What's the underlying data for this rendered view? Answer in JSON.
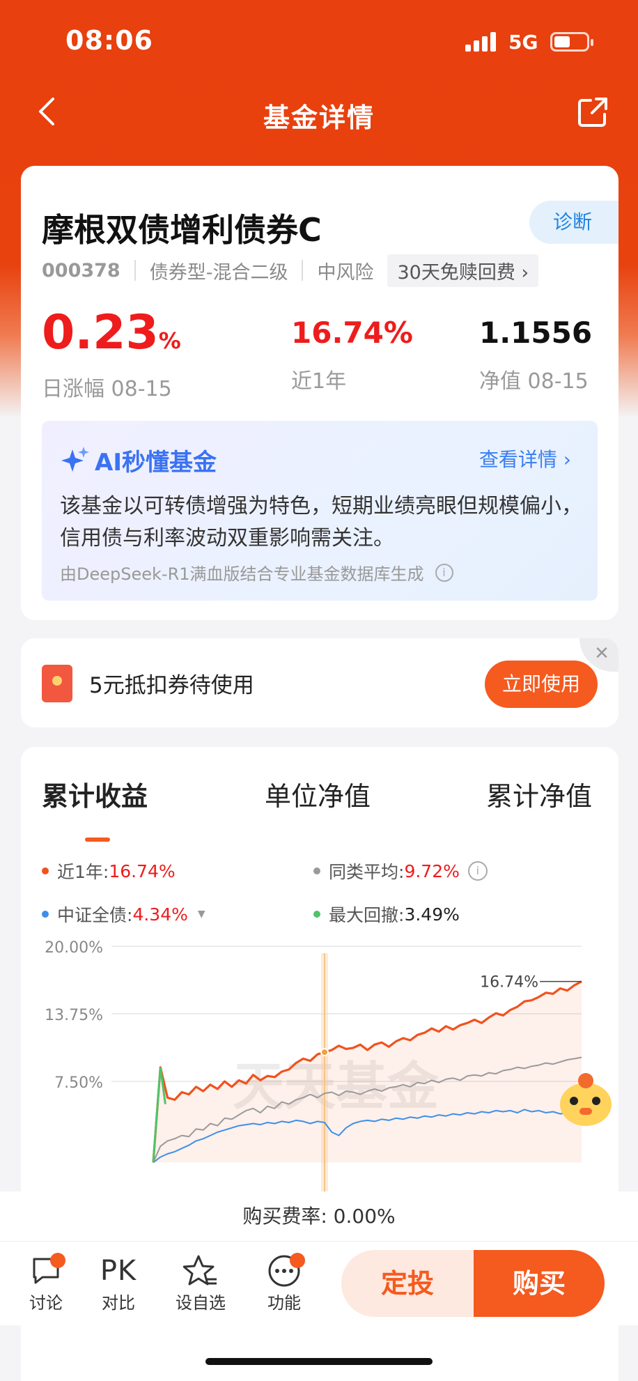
{
  "status": {
    "time": "08:06",
    "network": "5G"
  },
  "nav": {
    "title": "基金详情"
  },
  "fund": {
    "name": "摩根双债增利债券C",
    "diagnose_label": "诊断",
    "code": "000378",
    "type": "债券型-混合二级",
    "risk": "中风险",
    "promo": "30天免赎回费 ›",
    "daily_change": "0.23",
    "daily_change_unit": "%",
    "daily_change_label": "日涨幅 08-15",
    "year_return": "16.74%",
    "year_return_label": "近1年",
    "nav_value": "1.1556",
    "nav_label": "净值 08-15"
  },
  "ai": {
    "title": "AI秒懂基金",
    "more": "查看详情 ›",
    "summary": "该基金以可转债增强为特色，短期业绩亮眼但规模偏小，信用债与利率波动双重影响需关注。",
    "source": "由DeepSeek-R1满血版结合专业基金数据库生成",
    "info_glyph": "i"
  },
  "coupon": {
    "text": "5元抵扣券待使用",
    "button": "立即使用",
    "close_glyph": "✕"
  },
  "tabs": [
    "累计收益",
    "单位净值",
    "累计净值"
  ],
  "legend": {
    "near_year_label": "近1年:",
    "near_year_value": "16.74%",
    "peer_label": "同类平均:",
    "peer_value": "9.72%",
    "index_label": "中证全债:",
    "index_value": "4.34%",
    "drawdown_label": "最大回撤:",
    "drawdown_value": "3.49%",
    "info_glyph": "i",
    "dropdown_glyph": "▼"
  },
  "colors": {
    "fund": "#f0521e",
    "peer": "#9a9a9a",
    "index": "#3d8fe8",
    "drawdown": "#4ec46a",
    "accent": "#f55a1f",
    "up": "#ee1c1c"
  },
  "chart_data": {
    "type": "line",
    "yticks": [
      "20.00%",
      "13.75%",
      "7.50%"
    ],
    "ylim": [
      0,
      20
    ],
    "end_label": "16.74%",
    "watermark": "天天基金",
    "x": [
      0,
      1,
      2,
      3,
      4,
      5,
      6,
      7,
      8,
      9,
      10,
      11,
      12,
      13,
      14,
      15,
      16,
      17,
      18,
      19,
      20,
      21,
      22,
      23,
      24,
      25,
      26,
      27,
      28,
      29,
      30,
      31,
      32,
      33,
      34,
      35,
      36,
      37,
      38,
      39,
      40,
      41,
      42,
      43,
      44,
      45,
      46,
      47,
      48,
      49,
      50,
      51,
      52,
      53,
      54,
      55,
      56,
      57,
      58,
      59,
      60
    ],
    "series": [
      {
        "name": "近1年",
        "values": [
          0,
          8.8,
          6.0,
          5.8,
          6.5,
          6.3,
          7.0,
          6.6,
          7.2,
          6.8,
          7.5,
          7.0,
          7.6,
          7.3,
          8.1,
          7.6,
          8.0,
          7.9,
          8.4,
          8.6,
          9.2,
          9.6,
          9.4,
          10.0,
          10.2,
          10.4,
          10.8,
          10.5,
          10.6,
          10.9,
          10.4,
          10.9,
          11.1,
          10.7,
          11.2,
          11.5,
          11.3,
          11.8,
          12.0,
          12.4,
          12.1,
          12.6,
          12.3,
          12.7,
          12.9,
          13.2,
          12.9,
          13.4,
          13.8,
          13.6,
          14.1,
          14.4,
          14.9,
          15.0,
          15.3,
          15.7,
          15.6,
          16.1,
          15.9,
          16.4,
          16.74
        ]
      },
      {
        "name": "同类平均",
        "values": [
          0,
          1.5,
          2.0,
          2.2,
          2.5,
          2.4,
          3.1,
          3.0,
          3.6,
          3.4,
          4.1,
          4.0,
          4.4,
          4.8,
          5.0,
          4.6,
          5.2,
          5.0,
          5.6,
          5.4,
          5.8,
          6.0,
          6.3,
          6.0,
          6.4,
          6.5,
          6.2,
          6.6,
          6.5,
          6.3,
          6.6,
          6.8,
          6.6,
          6.9,
          7.0,
          7.2,
          7.0,
          7.4,
          7.3,
          7.6,
          7.4,
          7.7,
          7.8,
          7.6,
          8.0,
          8.1,
          8.0,
          8.3,
          8.2,
          8.5,
          8.6,
          8.8,
          8.7,
          8.9,
          9.0,
          9.2,
          9.1,
          9.3,
          9.5,
          9.6,
          9.72
        ]
      },
      {
        "name": "中证全债",
        "values": [
          0,
          0.5,
          0.8,
          1.0,
          1.3,
          1.6,
          2.0,
          2.2,
          2.5,
          2.8,
          3.0,
          3.2,
          3.4,
          3.5,
          3.6,
          3.5,
          3.7,
          3.6,
          3.8,
          3.7,
          3.9,
          3.8,
          3.6,
          3.8,
          3.7,
          2.8,
          2.5,
          3.2,
          3.6,
          3.8,
          3.9,
          3.8,
          4.0,
          3.9,
          4.1,
          4.0,
          4.2,
          4.1,
          4.3,
          4.2,
          4.4,
          4.3,
          4.5,
          4.4,
          4.6,
          4.5,
          4.7,
          4.6,
          4.8,
          4.7,
          4.8,
          4.6,
          4.9,
          4.7,
          4.8,
          4.6,
          4.7,
          4.5,
          4.6,
          4.4,
          4.34
        ]
      }
    ]
  },
  "footer": {
    "fee": "购买费率: 0.00%",
    "discuss": "讨论",
    "pk_glyph": "PK",
    "compare": "对比",
    "watchlist": "设自选",
    "more": "功能",
    "sip": "定投",
    "buy": "购买"
  }
}
